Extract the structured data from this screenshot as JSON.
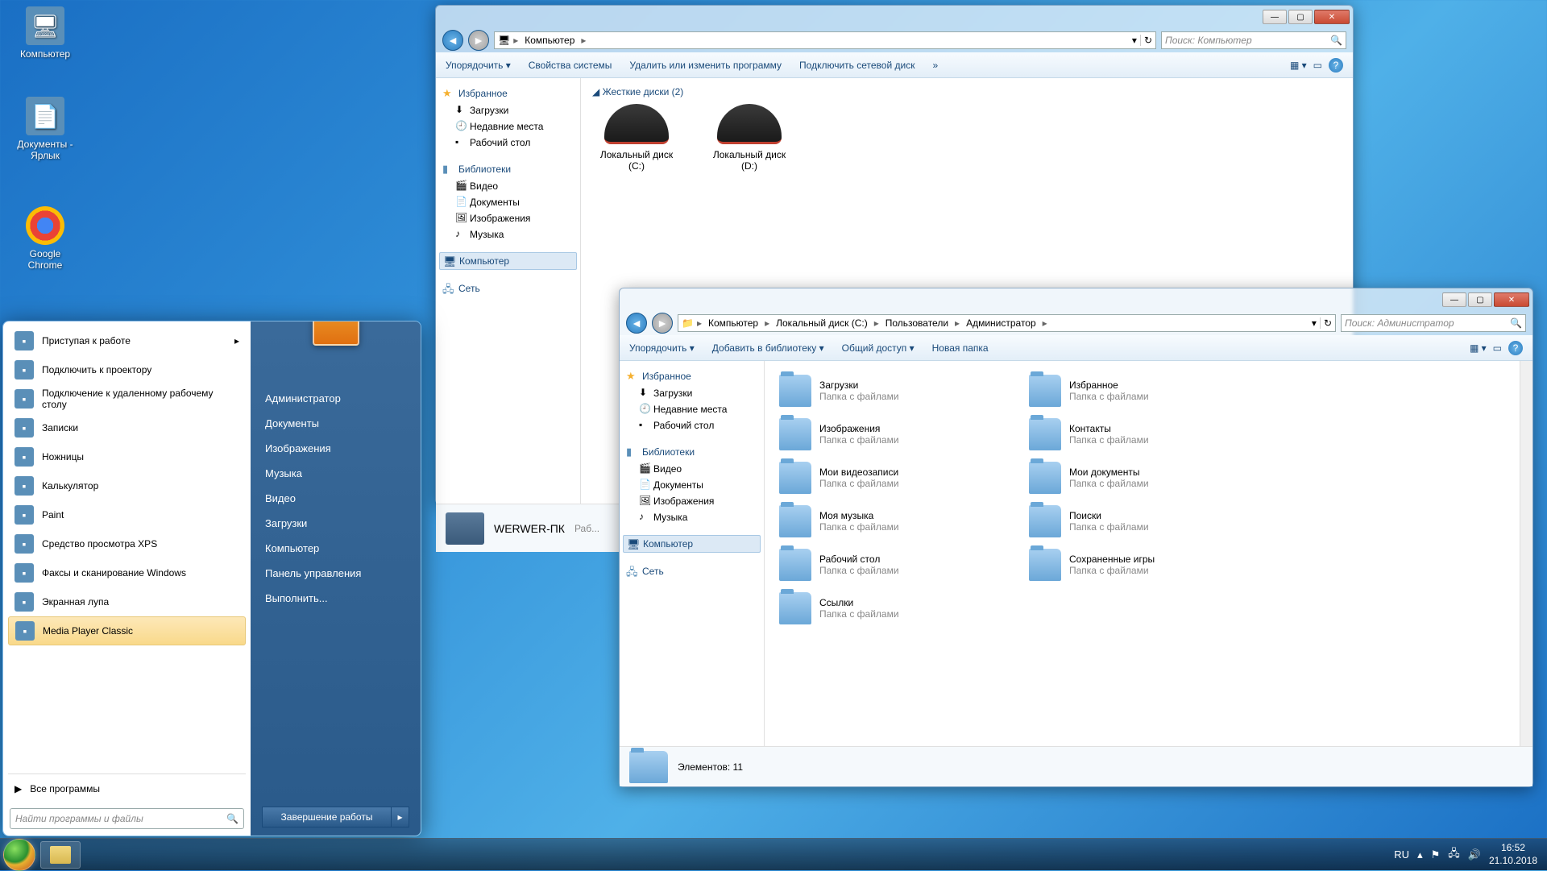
{
  "desktop_icons": [
    {
      "label": "Компьютер",
      "glyph": "🖥"
    },
    {
      "label": "Документы - Ярлык",
      "glyph": "📄"
    },
    {
      "label": "Google Chrome",
      "glyph": "◉"
    }
  ],
  "win1": {
    "breadcrumbs": [
      "Компьютер"
    ],
    "search_placeholder": "Поиск: Компьютер",
    "toolbar": [
      "Упорядочить ▾",
      "Свойства системы",
      "Удалить или изменить программу",
      "Подключить сетевой диск",
      "»"
    ],
    "sidebar": {
      "fav": {
        "hdr": "Избранное",
        "items": [
          "Загрузки",
          "Недавние места",
          "Рабочий стол"
        ]
      },
      "lib": {
        "hdr": "Библиотеки",
        "items": [
          "Видео",
          "Документы",
          "Изображения",
          "Музыка"
        ]
      },
      "comp": "Компьютер",
      "net": "Сеть"
    },
    "content_hdr": "Жесткие диски (2)",
    "drives": [
      {
        "name": "Локальный диск (C:)"
      },
      {
        "name": "Локальный диск (D:)"
      }
    ],
    "details": {
      "name": "WERWER-ПК",
      "sub": "Раб..."
    }
  },
  "win2": {
    "breadcrumbs": [
      "Компьютер",
      "Локальный диск (C:)",
      "Пользователи",
      "Администратор"
    ],
    "search_placeholder": "Поиск: Администратор",
    "toolbar": [
      "Упорядочить ▾",
      "Добавить в библиотеку ▾",
      "Общий доступ ▾",
      "Новая папка"
    ],
    "sidebar": {
      "fav": {
        "hdr": "Избранное",
        "items": [
          "Загрузки",
          "Недавние места",
          "Рабочий стол"
        ]
      },
      "lib": {
        "hdr": "Библиотеки",
        "items": [
          "Видео",
          "Документы",
          "Изображения",
          "Музыка"
        ]
      },
      "comp": "Компьютер",
      "net": "Сеть"
    },
    "folders": [
      {
        "n": "Загрузки",
        "t": "Папка с файлами"
      },
      {
        "n": "Избранное",
        "t": "Папка с файлами"
      },
      {
        "n": "Изображения",
        "t": "Папка с файлами"
      },
      {
        "n": "Контакты",
        "t": "Папка с файлами"
      },
      {
        "n": "Мои видеозаписи",
        "t": "Папка с файлами"
      },
      {
        "n": "Мои документы",
        "t": "Папка с файлами"
      },
      {
        "n": "Моя музыка",
        "t": "Папка с файлами"
      },
      {
        "n": "Поиски",
        "t": "Папка с файлами"
      },
      {
        "n": "Рабочий стол",
        "t": "Папка с файлами"
      },
      {
        "n": "Сохраненные игры",
        "t": "Папка с файлами"
      },
      {
        "n": "Ссылки",
        "t": "Папка с файлами"
      }
    ],
    "status": "Элементов: 11"
  },
  "startmenu": {
    "left": [
      {
        "label": "Приступая к работе",
        "arrow": true
      },
      {
        "label": "Подключить к проектору"
      },
      {
        "label": "Подключение к удаленному рабочему столу"
      },
      {
        "label": "Записки"
      },
      {
        "label": "Ножницы"
      },
      {
        "label": "Калькулятор"
      },
      {
        "label": "Paint"
      },
      {
        "label": "Средство просмотра XPS"
      },
      {
        "label": "Факсы и сканирование Windows"
      },
      {
        "label": "Экранная лупа"
      },
      {
        "label": "Media Player Classic",
        "hl": true
      }
    ],
    "allprograms": "Все программы",
    "search_placeholder": "Найти программы и файлы",
    "right": [
      "Администратор",
      "Документы",
      "Изображения",
      "Музыка",
      "Видео",
      "Загрузки",
      "Компьютер",
      "Панель управления",
      "Выполнить..."
    ],
    "shutdown": "Завершение работы"
  },
  "taskbar": {
    "lang": "RU",
    "time": "16:52",
    "date": "21.10.2018"
  }
}
